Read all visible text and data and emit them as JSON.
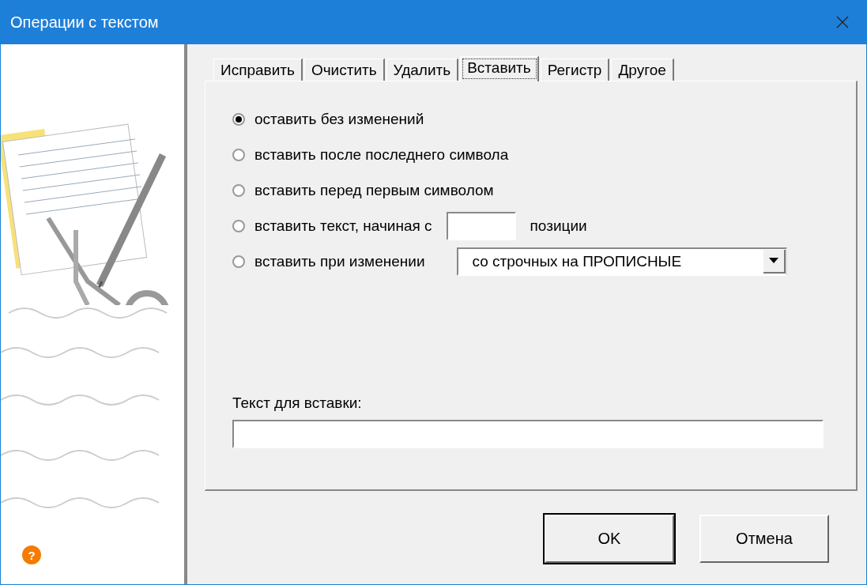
{
  "window": {
    "title": "Операции с текстом"
  },
  "help_badge": "?",
  "tabs": [
    {
      "label": "Исправить",
      "selected": false
    },
    {
      "label": "Очистить",
      "selected": false
    },
    {
      "label": "Удалить",
      "selected": false
    },
    {
      "label": "Вставить",
      "selected": true
    },
    {
      "label": "Регистр",
      "selected": false
    },
    {
      "label": "Другое",
      "selected": false
    }
  ],
  "options": [
    {
      "kind": "plain",
      "label": "оставить без изменений",
      "selected": true
    },
    {
      "kind": "plain",
      "label": "вставить после последнего символа",
      "selected": false
    },
    {
      "kind": "plain",
      "label": "вставить перед первым символом",
      "selected": false
    },
    {
      "kind": "position",
      "label": "вставить текст, начиная с",
      "suffix": "позиции",
      "selected": false
    },
    {
      "kind": "dropdown",
      "label": "вставить при изменении",
      "value": "со строчных на ПРОПИСНЫЕ",
      "selected": false
    }
  ],
  "insert_text": {
    "label": "Текст для вставки:"
  },
  "buttons": [
    {
      "label": "OK",
      "default": true
    },
    {
      "label": "Отмена",
      "default": false
    }
  ]
}
